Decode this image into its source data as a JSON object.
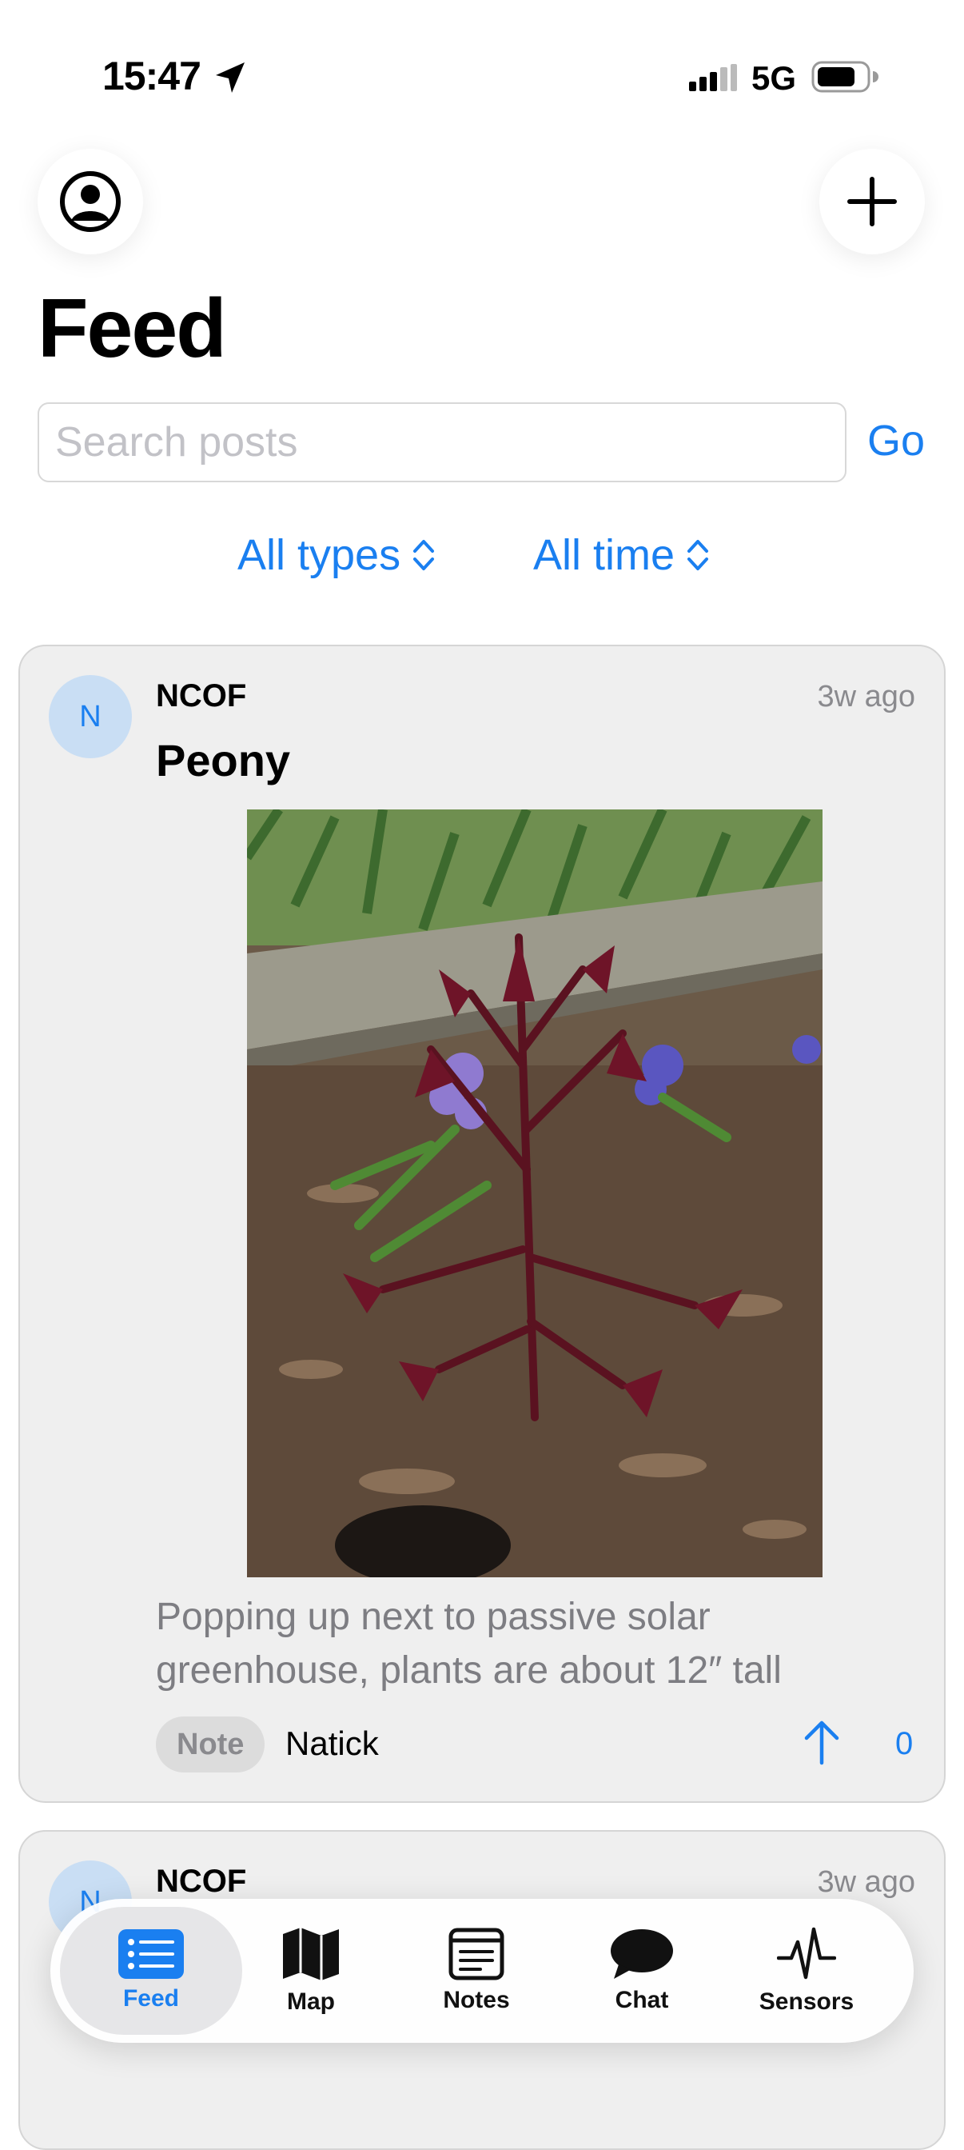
{
  "status_bar": {
    "time": "15:47",
    "network": "5G"
  },
  "header": {
    "title": "Feed"
  },
  "search": {
    "placeholder": "Search posts",
    "value": "",
    "go_label": "Go"
  },
  "filters": {
    "type": "All types",
    "time": "All time"
  },
  "posts": [
    {
      "avatar_initial": "N",
      "author": "NCOF",
      "time_ago": "3w ago",
      "title": "Peony",
      "body": "Popping up next to passive solar greenhouse, plants are about 12″ tall",
      "tag": "Note",
      "location": "Natick",
      "votes": "0"
    },
    {
      "avatar_initial": "N",
      "author": "NCOF",
      "time_ago": "3w ago"
    }
  ],
  "tabs": [
    {
      "label": "Feed",
      "icon": "list-icon",
      "active": true
    },
    {
      "label": "Map",
      "icon": "map-icon",
      "active": false
    },
    {
      "label": "Notes",
      "icon": "notes-icon",
      "active": false
    },
    {
      "label": "Chat",
      "icon": "chat-bubble-icon",
      "active": false
    },
    {
      "label": "Sensors",
      "icon": "waveform-icon",
      "active": false
    }
  ],
  "colors": {
    "accent": "#1a7ff0",
    "card_bg": "#efefef",
    "avatar_bg": "#c9def4"
  }
}
